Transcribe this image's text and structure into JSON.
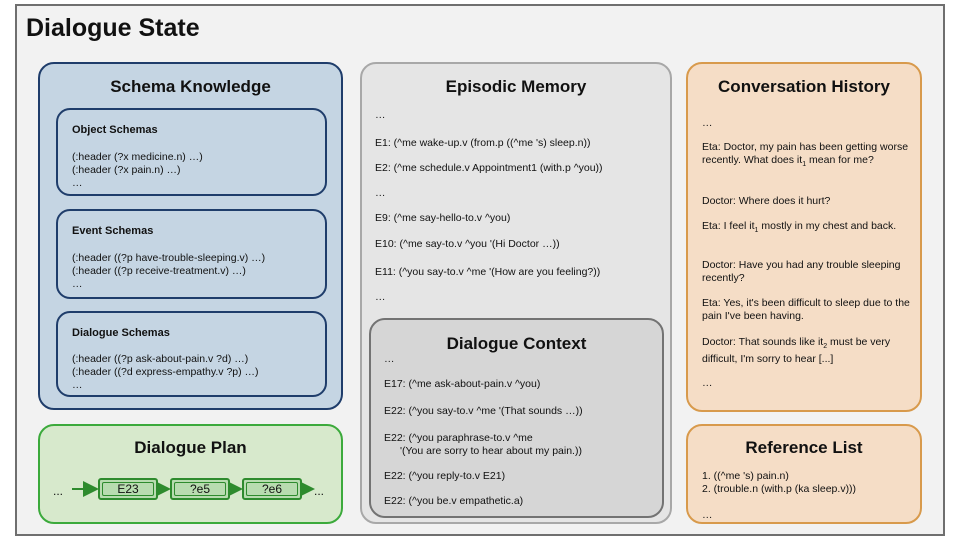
{
  "title": "Dialogue State",
  "schema_knowledge": {
    "title": "Schema Knowledge",
    "object": {
      "title": "Object Schemas",
      "lines": [
        "(:header (?x medicine.n) …)",
        "(:header (?x pain.n) …)",
        "…"
      ]
    },
    "event": {
      "title": "Event Schemas",
      "lines": [
        "(:header ((?p have-trouble-sleeping.v) …)",
        "(:header ((?p receive-treatment.v) …)",
        "…"
      ]
    },
    "dialogue": {
      "title": "Dialogue Schemas",
      "lines": [
        "(:header ((?p ask-about-pain.v ?d) …)",
        "(:header ((?d express-empathy.v ?p) …)",
        "…"
      ]
    }
  },
  "dialogue_plan": {
    "title": "Dialogue Plan",
    "ellipsis_left": "...",
    "ellipsis_right": "...",
    "nodes": [
      "E23",
      "?e5",
      "?e6"
    ]
  },
  "episodic_memory": {
    "title": "Episodic Memory",
    "lines": [
      "…",
      "E1: (^me wake-up.v (from.p ((^me 's) sleep.n))",
      "E2: (^me schedule.v Appointment1 (with.p ^you))",
      "…",
      "E9: (^me say-hello-to.v ^you)",
      "E10: (^me say-to.v ^you '(Hi Doctor …))",
      "E11: (^you say-to.v ^me '(How are you feeling?))",
      "…"
    ]
  },
  "dialogue_context": {
    "title": "Dialogue Context",
    "lines": [
      "…",
      "E17: (^me ask-about-pain.v ^you)",
      "E22: (^you say-to.v ^me '(That sounds …))",
      "E22: (^you paraphrase-to.v ^me",
      "'(You are sorry to hear about my pain.))",
      "E22: (^you reply-to.v E21)",
      "E22: (^you be.v empathetic.a)"
    ]
  },
  "conversation_history": {
    "title": "Conversation History",
    "lines": [
      "…",
      "Eta: Doctor, my pain has been getting worse recently. What does it",
      "1",
      "mean for me?",
      "Doctor: Where does it hurt?",
      "Eta: I feel it",
      "1",
      "mostly in my chest and back.",
      "Doctor: Have you had any trouble sleeping recently?",
      "Eta: Yes, it's been difficult to sleep due to the pain I've been having.",
      "Doctor: That sounds like it",
      "2",
      "must be very difficult, I'm sorry to hear [...]",
      "…"
    ]
  },
  "reference_list": {
    "title": "Reference List",
    "items": [
      "1. ((^me 's) pain.n)",
      "2. (trouble.n (with.p (ka sleep.v)))"
    ],
    "ellipsis": "…"
  }
}
